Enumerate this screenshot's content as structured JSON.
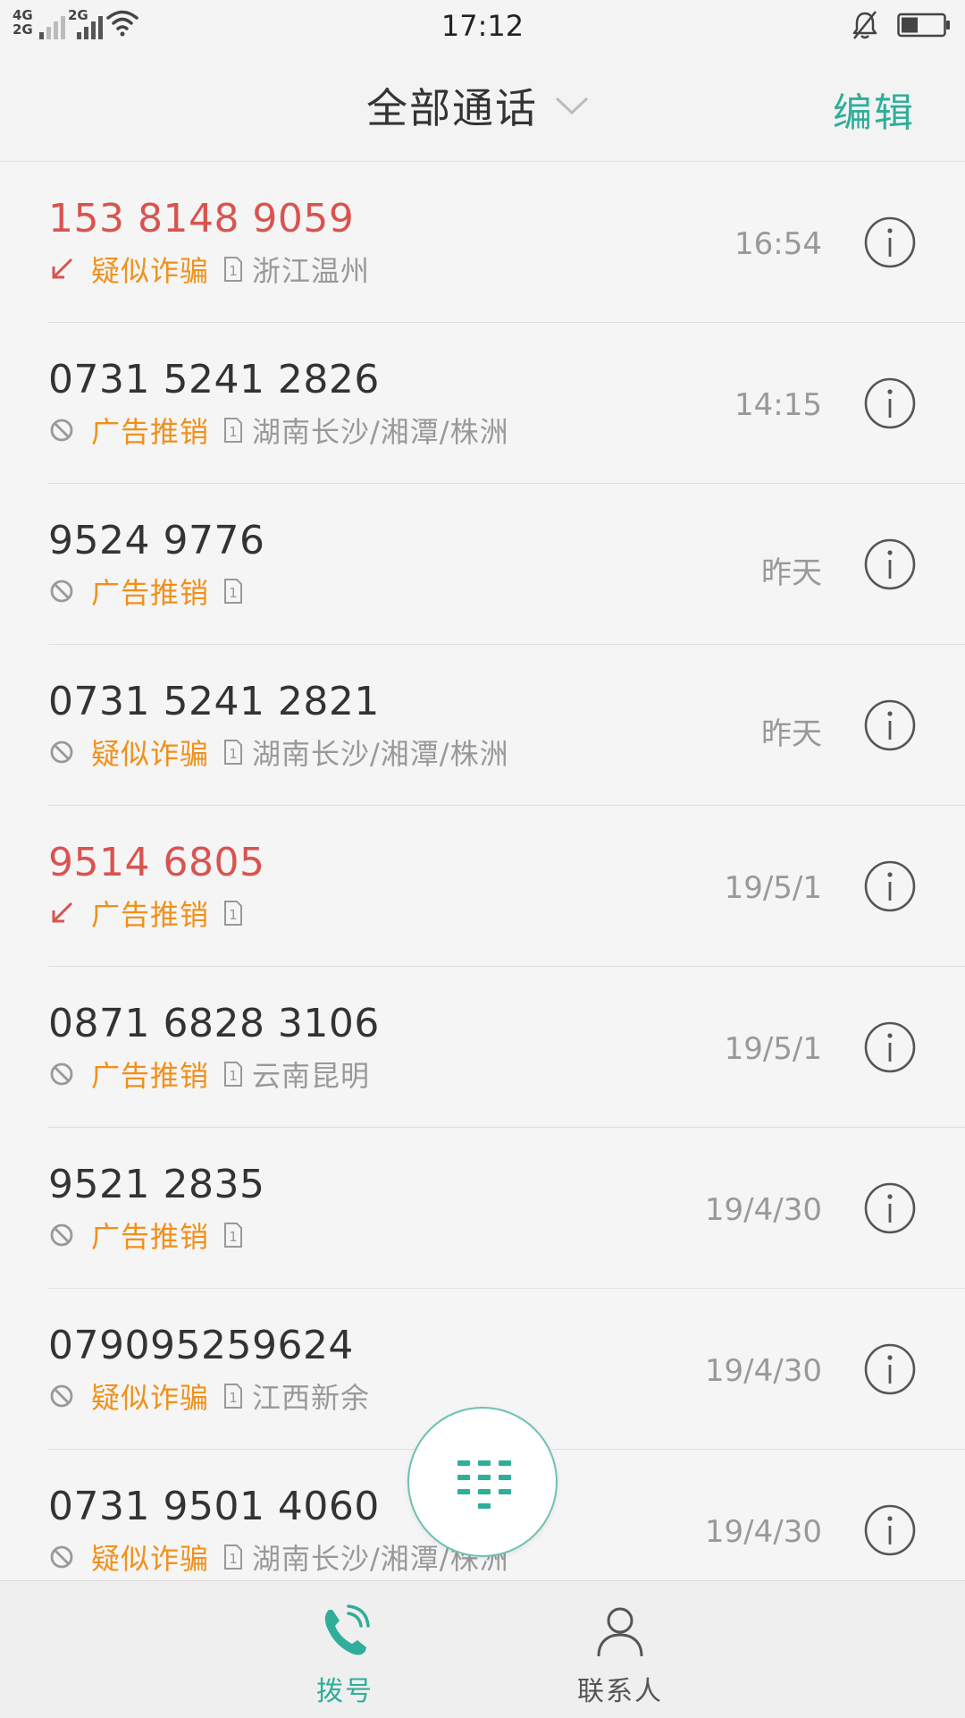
{
  "status_bar": {
    "network_top": "4G",
    "network_bottom": "2G",
    "network_second": "2G",
    "time": "17:12",
    "battery_level": 0.4
  },
  "header": {
    "title": "全部通话",
    "edit_label": "编辑"
  },
  "calls": [
    {
      "number": "153 8148 9059",
      "missed": true,
      "status_icon": "missed-call-arrow-icon",
      "tag": "疑似诈骗",
      "location": "浙江温州",
      "time": "16:54"
    },
    {
      "number": "0731 5241 2826",
      "missed": false,
      "status_icon": "blocked-icon",
      "tag": "广告推销",
      "location": "湖南长沙/湘潭/株洲",
      "time": "14:15"
    },
    {
      "number": "9524 9776",
      "missed": false,
      "status_icon": "blocked-icon",
      "tag": "广告推销",
      "location": "",
      "time": "昨天"
    },
    {
      "number": "0731 5241 2821",
      "missed": false,
      "status_icon": "blocked-icon",
      "tag": "疑似诈骗",
      "location": "湖南长沙/湘潭/株洲",
      "time": "昨天"
    },
    {
      "number": "9514 6805",
      "missed": true,
      "status_icon": "missed-call-arrow-icon",
      "tag": "广告推销",
      "location": "",
      "time": "19/5/1"
    },
    {
      "number": "0871 6828 3106",
      "missed": false,
      "status_icon": "blocked-icon",
      "tag": "广告推销",
      "location": "云南昆明",
      "time": "19/5/1"
    },
    {
      "number": "9521 2835",
      "missed": false,
      "status_icon": "blocked-icon",
      "tag": "广告推销",
      "location": "",
      "time": "19/4/30"
    },
    {
      "number": "079095259624",
      "missed": false,
      "status_icon": "blocked-icon",
      "tag": "疑似诈骗",
      "location": "江西新余",
      "time": "19/4/30"
    },
    {
      "number": "0731 9501 4060",
      "missed": false,
      "status_icon": "blocked-icon",
      "tag": "疑似诈骗",
      "location": "湖南长沙/湘潭/株洲",
      "time": "19/4/30"
    }
  ],
  "sim_label": "1",
  "bottom_nav": {
    "dial_label": "拨号",
    "contacts_label": "联系人"
  },
  "colors": {
    "accent": "#2fae9a",
    "missed": "#d85450",
    "tag": "#f0901a",
    "secondary_text": "#999999"
  }
}
